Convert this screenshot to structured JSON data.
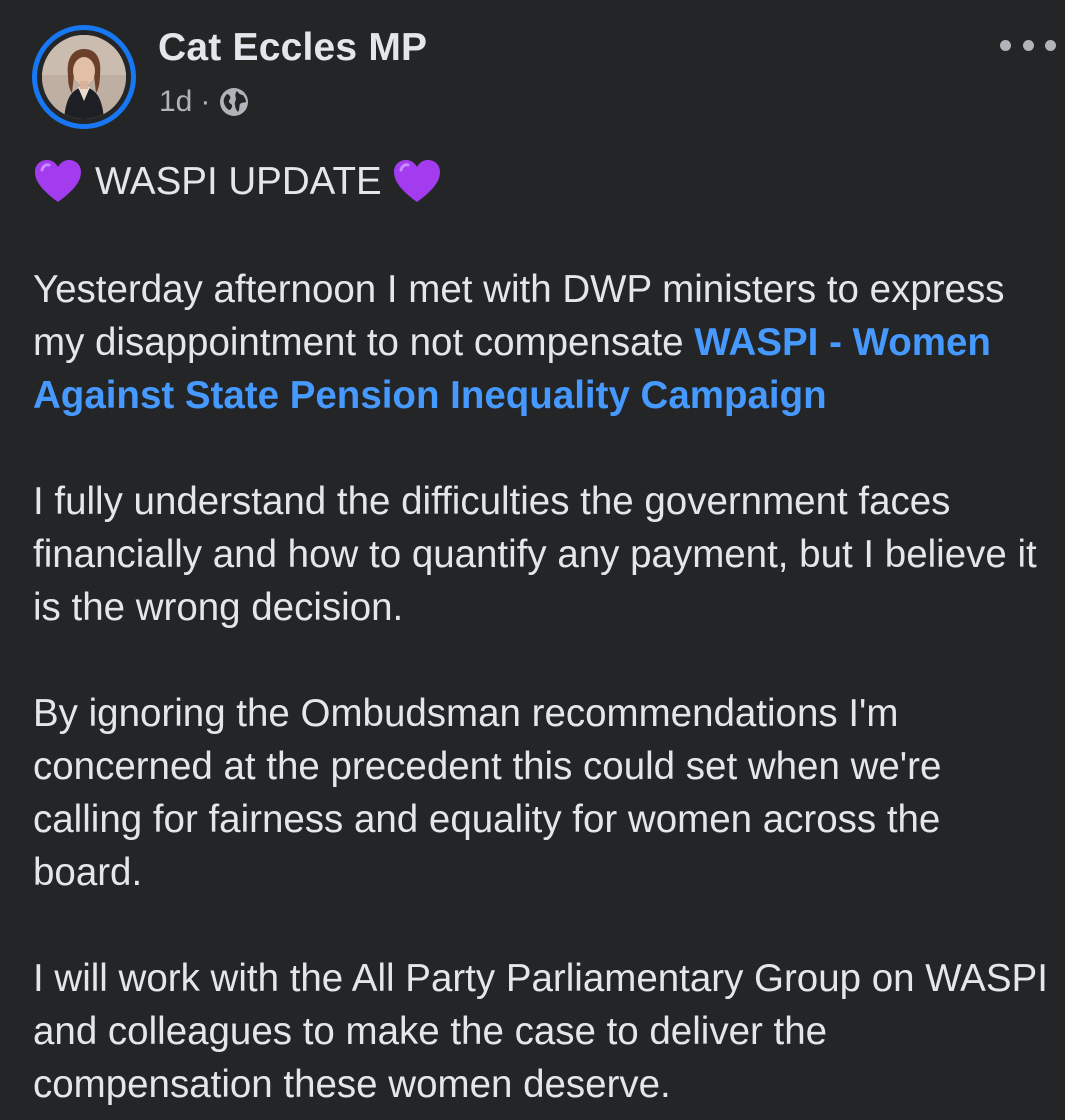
{
  "post": {
    "author": "Cat Eccles MP",
    "time": "1d",
    "separator": "·",
    "privacy_icon": "globe-icon",
    "more_icon": "more-options-icon",
    "heading": "WASPI UPDATE",
    "heading_icon": "purple-heart-icon",
    "paragraphs": {
      "p1_text": "Yesterday afternoon I met with DWP ministers to express my disappointment to not compensate ",
      "p1_link": "WASPI - Women Against State Pension Inequality Campaign",
      "p2": "I fully understand the difficulties the government faces financially and how to quantify any payment, but I believe it is the wrong decision.",
      "p3": "By ignoring the Ombudsman recommendations I'm concerned at the precedent this could set when we're calling for fairness and equality for women across the board.",
      "p4": "I will work with the All Party Parliamentary Group on WASPI and colleagues to make the case to deliver the compensation these women deserve."
    }
  },
  "colors": {
    "background": "#242526",
    "text": "#e4e6eb",
    "secondary_text": "#b0b3b8",
    "link": "#4599ff",
    "avatar_ring": "#1877f2",
    "heart": "#a33bef"
  }
}
